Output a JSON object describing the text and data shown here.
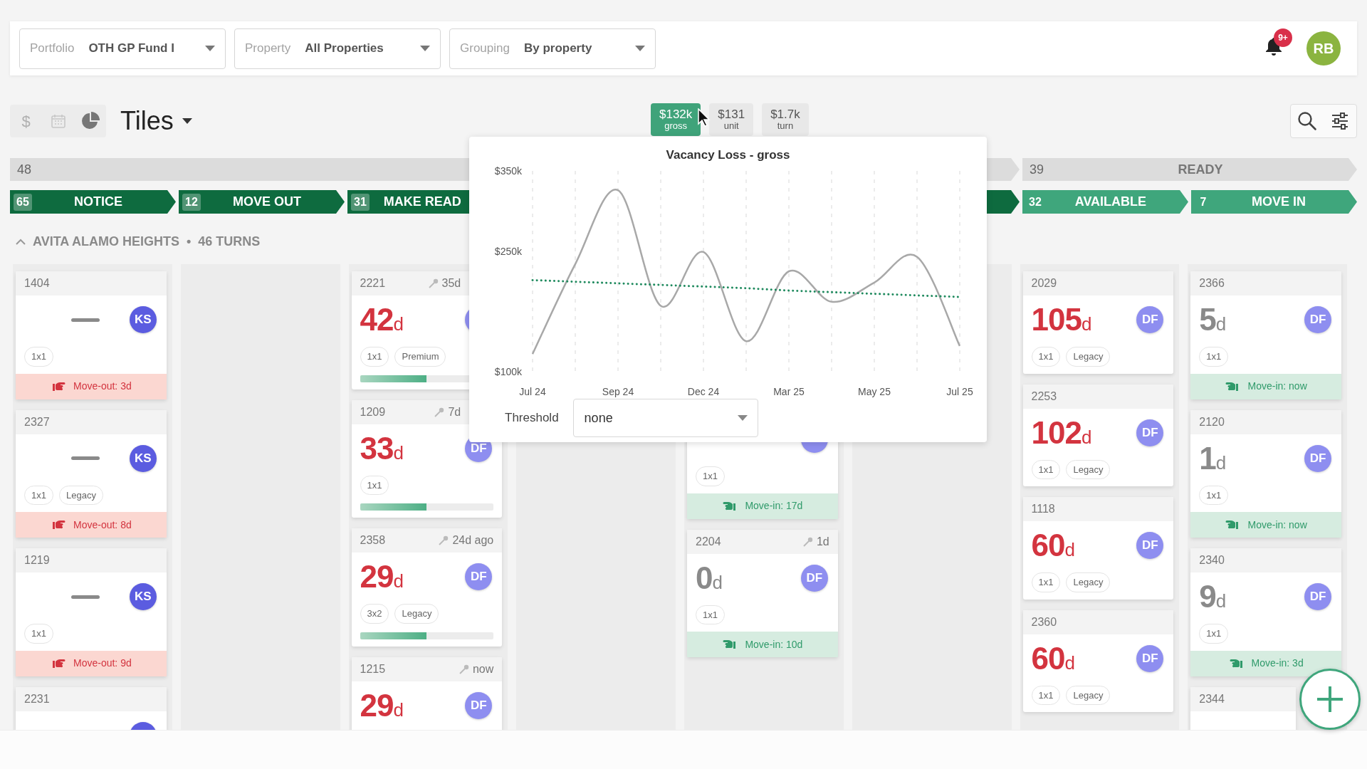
{
  "filters": [
    {
      "label": "Portfolio",
      "value": "OTH GP Fund I"
    },
    {
      "label": "Property",
      "value": "All Properties"
    },
    {
      "label": "Grouping",
      "value": "By property"
    }
  ],
  "notifications": {
    "badge": "9+"
  },
  "user": {
    "initials": "RB"
  },
  "views": [
    {
      "kind": "dollar",
      "label": "$",
      "selected": false
    },
    {
      "kind": "calendar",
      "selected": false
    },
    {
      "kind": "pie",
      "selected": true
    }
  ],
  "view_menu": {
    "value": "Tiles"
  },
  "metrics": [
    {
      "value": "$132k",
      "label": "gross",
      "selected": true
    },
    {
      "value": "$131",
      "label": "unit",
      "selected": false
    },
    {
      "value": "$1.7k",
      "label": "turn",
      "selected": false
    }
  ],
  "groups": [
    {
      "count": "48",
      "stages": [
        {
          "count": "65",
          "label": "NOTICE"
        },
        {
          "count": "12",
          "label": "MOVE OUT"
        },
        {
          "count": "31",
          "label": "MAKE READ"
        }
      ]
    },
    {
      "count": "39",
      "label": "READY",
      "stages": [
        {
          "count": "32",
          "label": "AVAILABLE"
        },
        {
          "count": "7",
          "label": "MOVE IN"
        }
      ]
    }
  ],
  "section": {
    "title": "AVITA ALAMO HEIGHTS",
    "separator": "•",
    "count": "46 TURNS",
    "expanded": true
  },
  "columns": [
    {
      "kind": "tiles",
      "tiles": [
        {
          "unit": "1404",
          "kind": "pending",
          "avatar": {
            "initials": "KS",
            "color": "#5b5ce0"
          },
          "tags": [
            "1x1"
          ],
          "footer": {
            "kind": "move-out",
            "text": "Move-out: 3d"
          }
        },
        {
          "unit": "2327",
          "kind": "pending",
          "avatar": {
            "initials": "KS",
            "color": "#5b5ce0"
          },
          "tags": [
            "1x1",
            "Legacy"
          ],
          "footer": {
            "kind": "move-out",
            "text": "Move-out: 8d"
          }
        },
        {
          "unit": "1219",
          "kind": "pending",
          "avatar": {
            "initials": "KS",
            "color": "#5b5ce0"
          },
          "tags": [
            "1x1"
          ],
          "footer": {
            "kind": "move-out",
            "text": "Move-out: 9d"
          }
        },
        {
          "unit": "2231",
          "kind": "pending",
          "avatar": {
            "color": "#5b5ce0"
          }
        }
      ]
    },
    {
      "kind": "empty"
    },
    {
      "kind": "tiles",
      "tiles": [
        {
          "unit": "2221",
          "key": "35d",
          "kind": "days",
          "days": "42",
          "suffix": "d",
          "overdue": true,
          "avatar": {
            "color": "#8e8ef0"
          },
          "tags": [
            "1x1",
            "Premium"
          ],
          "level": 0.5
        },
        {
          "unit": "1209",
          "key": "7d",
          "kind": "days",
          "days": "33",
          "suffix": "d",
          "overdue": true,
          "avatar": {
            "initials": "DF",
            "color": "#8e8ef0"
          },
          "tags": [
            "1x1"
          ],
          "level": 0.5
        },
        {
          "unit": "2358",
          "key": "24d ago",
          "kind": "days",
          "days": "29",
          "suffix": "d",
          "overdue": true,
          "avatar": {
            "initials": "DF",
            "color": "#8e8ef0"
          },
          "tags": [
            "3x2",
            "Legacy"
          ],
          "level": 0.5
        },
        {
          "unit": "1215",
          "key": "now",
          "kind": "days",
          "days": "29",
          "suffix": "d",
          "overdue": true,
          "avatar": {
            "initials": "DF",
            "color": "#8e8ef0"
          }
        }
      ]
    },
    {
      "kind": "empty"
    },
    {
      "kind": "tiles",
      "tiles": [
        {
          "kind": "days",
          "avatar": {
            "color": "#8e8ef0"
          },
          "tags": [
            "1x1"
          ],
          "footer": {
            "kind": "move-in",
            "text": "Move-in: 17d"
          }
        },
        {
          "unit": "2204",
          "key": "1d",
          "kind": "days",
          "days": "0",
          "suffix": "d",
          "overdue": false,
          "avatar": {
            "initials": "DF",
            "color": "#8e8ef0"
          },
          "tags": [
            "1x1"
          ],
          "footer": {
            "kind": "move-in",
            "text": "Move-in: 10d"
          }
        }
      ]
    },
    {
      "kind": "empty"
    },
    {
      "kind": "tiles",
      "tiles": [
        {
          "unit": "2029",
          "kind": "days",
          "days": "105",
          "suffix": "d",
          "overdue": true,
          "avatar": {
            "initials": "DF",
            "color": "#8e8ef0"
          },
          "tags": [
            "1x1",
            "Legacy"
          ]
        },
        {
          "unit": "2253",
          "kind": "days",
          "days": "102",
          "suffix": "d",
          "overdue": true,
          "avatar": {
            "initials": "DF",
            "color": "#8e8ef0"
          },
          "tags": [
            "1x1",
            "Legacy"
          ]
        },
        {
          "unit": "1118",
          "kind": "days",
          "days": "60",
          "suffix": "d",
          "overdue": true,
          "avatar": {
            "initials": "DF",
            "color": "#8e8ef0"
          },
          "tags": [
            "1x1",
            "Legacy"
          ]
        },
        {
          "unit": "2360",
          "kind": "days",
          "days": "60",
          "suffix": "d",
          "overdue": true,
          "avatar": {
            "initials": "DF",
            "color": "#8e8ef0"
          },
          "tags": [
            "1x1",
            "Legacy"
          ]
        }
      ]
    },
    {
      "kind": "tiles",
      "tiles": [
        {
          "unit": "2366",
          "kind": "days",
          "days": "5",
          "suffix": "d",
          "overdue": false,
          "avatar": {
            "initials": "DF",
            "color": "#8e8ef0"
          },
          "tags": [
            "1x1"
          ],
          "footer": {
            "kind": "move-in",
            "text": "Move-in: now"
          }
        },
        {
          "unit": "2120",
          "kind": "days",
          "days": "1",
          "suffix": "d",
          "overdue": false,
          "avatar": {
            "initials": "DF",
            "color": "#8e8ef0"
          },
          "tags": [
            "1x1"
          ],
          "footer": {
            "kind": "move-in",
            "text": "Move-in: now"
          }
        },
        {
          "unit": "2340",
          "kind": "days",
          "days": "9",
          "suffix": "d",
          "overdue": false,
          "avatar": {
            "initials": "DF",
            "color": "#8e8ef0"
          },
          "tags": [
            "1x1"
          ],
          "footer": {
            "kind": "move-in",
            "text": "Move-in: 3d"
          }
        },
        {
          "unit": "2344",
          "kind": "days"
        }
      ]
    }
  ],
  "popup": {
    "chart_data": {
      "type": "line",
      "title": "Vacancy Loss - gross",
      "grid": true,
      "categories": [
        "Jul 24",
        null,
        "Sep 24",
        null,
        "Dec 24",
        null,
        "Mar 25",
        null,
        "May 25",
        null,
        "Jul 25"
      ],
      "ylim": [
        100,
        350
      ],
      "yticks": [
        {
          "value": 100,
          "label": "$100k"
        },
        {
          "value": 250,
          "label": "$250k"
        },
        {
          "value": 350,
          "label": "$350k"
        }
      ],
      "series": [
        {
          "color": "#a8a8a8",
          "line_style": "solid",
          "values": [
            122,
            234,
            326,
            182,
            249,
            138,
            225,
            187,
            211,
            243,
            132
          ]
        },
        {
          "color": "#1f8a5e",
          "line_style": "dotted",
          "values": [
            214,
            212,
            210,
            208,
            206,
            204,
            201,
            199,
            197,
            195,
            193
          ]
        }
      ]
    },
    "threshold": {
      "label": "Threshold",
      "value": "none"
    }
  }
}
